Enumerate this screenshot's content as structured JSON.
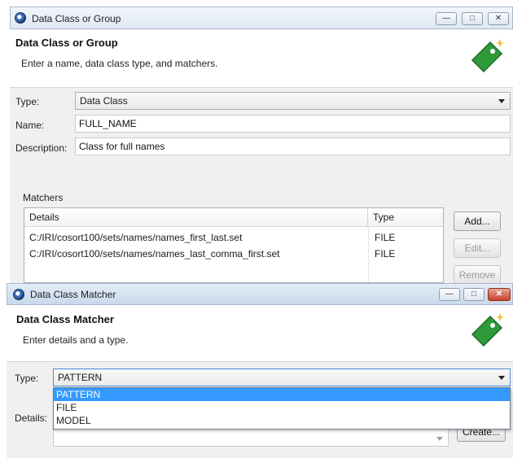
{
  "window1": {
    "title": "Data Class or Group",
    "header_title": "Data Class or Group",
    "header_desc": "Enter a name, data class type, and matchers.",
    "type_label": "Type:",
    "type_value": "Data Class",
    "name_label": "Name:",
    "name_value": "FULL_NAME",
    "desc_label": "Description:",
    "desc_value": "Class for full names",
    "matchers_label": "Matchers",
    "table": {
      "columns": [
        "Details",
        "Type"
      ],
      "rows": [
        {
          "details": "C:/IRI/cosort100/sets/names/names_first_last.set",
          "type": "FILE"
        },
        {
          "details": "C:/IRI/cosort100/sets/names/names_last_comma_first.set",
          "type": "FILE"
        }
      ]
    },
    "buttons": {
      "add": "Add...",
      "edit": "Edit...",
      "remove": "Remove"
    }
  },
  "window2": {
    "title": "Data Class Matcher",
    "header_title": "Data Class Matcher",
    "header_desc": "Enter details and a type.",
    "type_label": "Type:",
    "type_value": "PATTERN",
    "options": [
      "PATTERN",
      "FILE",
      "MODEL"
    ],
    "details_label": "Details:",
    "create_label": "Create..."
  },
  "icons": [
    "app-icon",
    "tag-icon",
    "minimize-icon",
    "maximize-icon",
    "close-icon",
    "chevron-down-icon"
  ],
  "colors": {
    "selection": "#3399ff",
    "tag_green": "#2e9a3a",
    "sparkle": "#f0c030"
  }
}
